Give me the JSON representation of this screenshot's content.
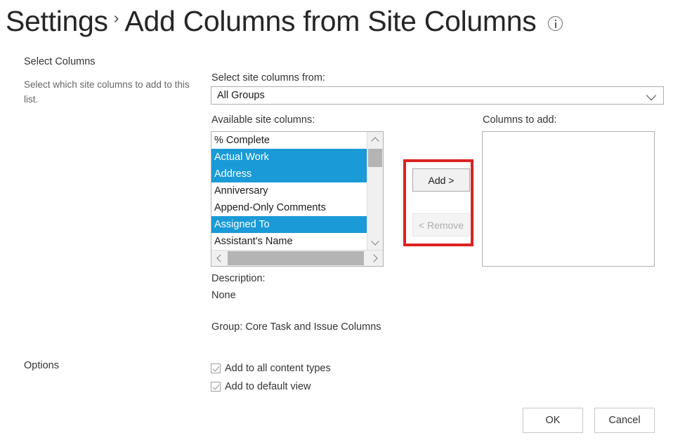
{
  "header": {
    "breadcrumb_parent": "Settings",
    "separator": "›",
    "title": "Add Columns from Site Columns",
    "info_icon": "info-icon"
  },
  "sections": {
    "select_columns": {
      "label": "Select Columns",
      "description": "Select which site columns to add to this list."
    },
    "options": {
      "label": "Options"
    }
  },
  "form": {
    "site_columns_from_label": "Select site columns from:",
    "site_columns_from_value": "All Groups",
    "available_label": "Available site columns:",
    "columns_to_add_label": "Columns to add:",
    "available_columns": [
      {
        "label": "% Complete",
        "selected": false
      },
      {
        "label": "Actual Work",
        "selected": true
      },
      {
        "label": "Address",
        "selected": true
      },
      {
        "label": "Anniversary",
        "selected": false
      },
      {
        "label": "Append-Only Comments",
        "selected": false
      },
      {
        "label": "Assigned To",
        "selected": true
      },
      {
        "label": "Assistant's Name",
        "selected": false
      }
    ],
    "columns_to_add": [],
    "add_button": "Add >",
    "remove_button": "< Remove",
    "remove_disabled": true,
    "description_heading": "Description:",
    "description_value": "None",
    "group_text": "Group: Core Task and Issue Columns"
  },
  "options": [
    {
      "label": "Add to all content types",
      "checked": true
    },
    {
      "label": "Add to default view",
      "checked": true
    }
  ],
  "footer": {
    "ok_label": "OK",
    "cancel_label": "Cancel"
  },
  "colors": {
    "selection_blue": "#1a9ad7",
    "highlight_red": "#dd2222",
    "text_primary": "#333333",
    "text_muted": "#666666",
    "border_gray": "#b0b0b0"
  }
}
